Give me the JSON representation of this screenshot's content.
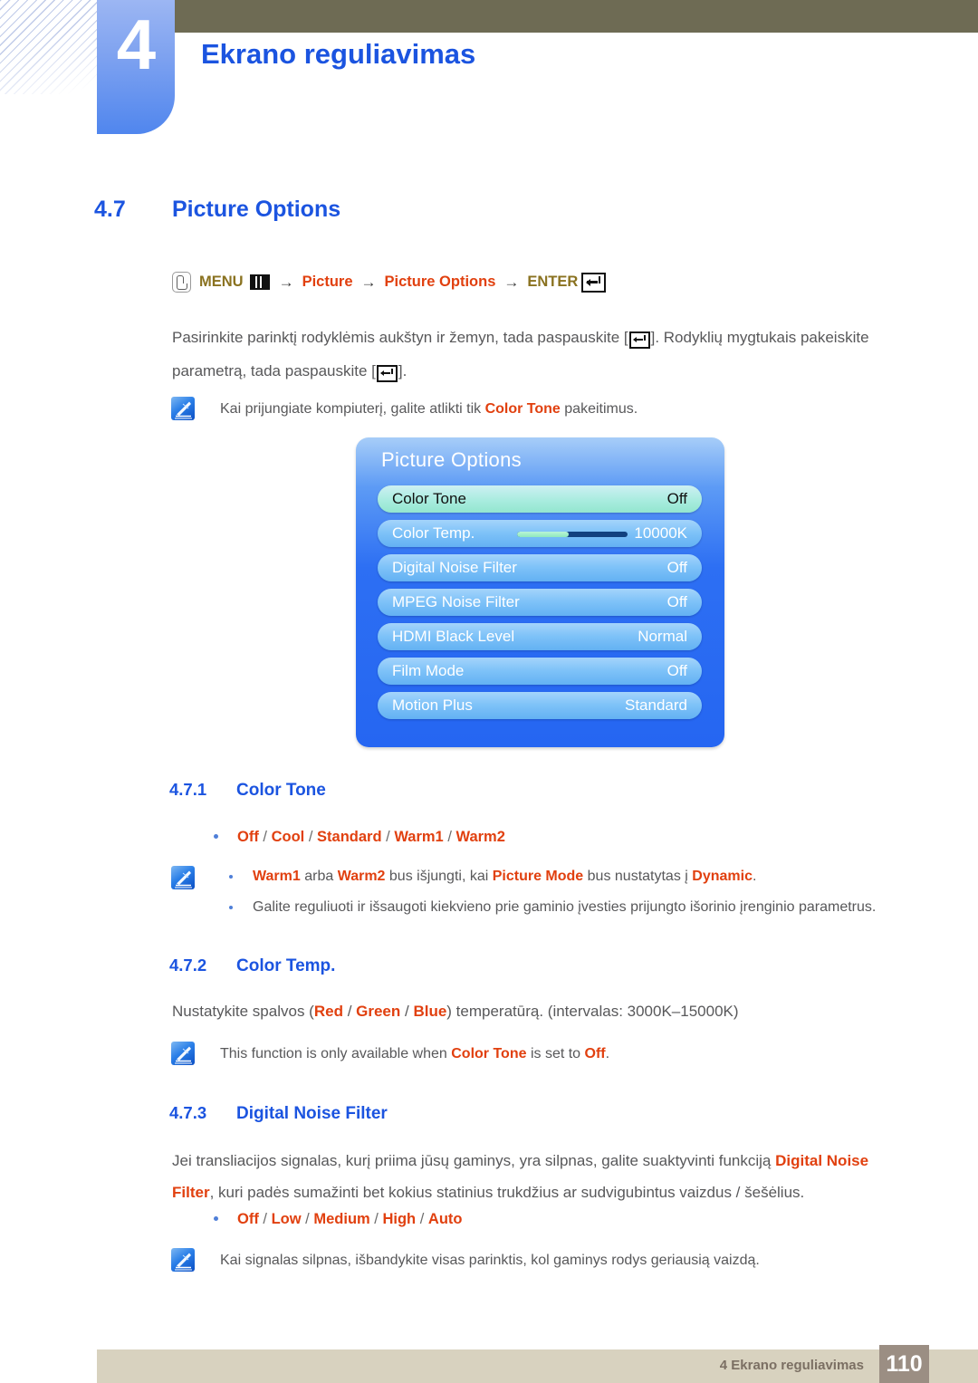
{
  "header": {
    "chapter_number": "4",
    "chapter_title": "Ekrano reguliavimas",
    "accent_blue": "#1b54e0",
    "olive_bar_color": "#6e6b54",
    "tab_gradient_from": "#9cb6f3",
    "tab_gradient_to": "#5086ee"
  },
  "section": {
    "number": "4.7",
    "title": "Picture Options"
  },
  "menu_path": {
    "press_icon": "press-hand-icon",
    "menu_label": "MENU",
    "grid_icon": "menu-grid-icon",
    "arrow": "→",
    "item1": "Picture",
    "item2": "Picture Options",
    "enter_label": "ENTER",
    "enter_icon": "enter-key-icon",
    "olive_color": "#8a7220",
    "orange_color": "#e1400f"
  },
  "intro": {
    "line1_a": "Pasirinkite parinktį rodyklėmis aukštyn ir žemyn, tada paspauskite [",
    "line1_b": "]. Rodyklių mygtukais pakeiskite",
    "line2_a": "parametrą, tada paspauskite [",
    "line2_b": "]."
  },
  "note_top": {
    "icon": "note-pen-icon",
    "text_a": "Kai prijungiate kompiuterį, galite atlikti tik ",
    "highlight": "Color Tone",
    "text_b": " pakeitimus."
  },
  "osd": {
    "title": "Picture Options",
    "rows": [
      {
        "label": "Color Tone",
        "value": "Off",
        "selected": true,
        "slider": false
      },
      {
        "label": "Color Temp.",
        "value": "10000K",
        "selected": false,
        "slider": true,
        "slider_fill_percent": 47
      },
      {
        "label": "Digital Noise Filter",
        "value": "Off",
        "selected": false,
        "slider": false
      },
      {
        "label": "MPEG Noise Filter",
        "value": "Off",
        "selected": false,
        "slider": false
      },
      {
        "label": "HDMI Black Level",
        "value": "Normal",
        "selected": false,
        "slider": false
      },
      {
        "label": "Film Mode",
        "value": "Off",
        "selected": false,
        "slider": false
      },
      {
        "label": "Motion Plus",
        "value": "Standard",
        "selected": false,
        "slider": false
      }
    ]
  },
  "sub471": {
    "number": "4.7.1",
    "title": "Color Tone",
    "options": [
      "Off",
      "Cool",
      "Standard",
      "Warm1",
      "Warm2"
    ],
    "note_icon": "note-pen-icon",
    "note1_parts": [
      {
        "t": "Warm1",
        "hl": true
      },
      {
        "t": " arba ",
        "hl": false
      },
      {
        "t": "Warm2",
        "hl": true
      },
      {
        "t": " bus išjungti, kai ",
        "hl": false
      },
      {
        "t": "Picture Mode",
        "hl": true
      },
      {
        "t": " bus nustatytas į ",
        "hl": false
      },
      {
        "t": "Dynamic",
        "hl": true
      },
      {
        "t": ".",
        "hl": false
      }
    ],
    "note2": "Galite reguliuoti ir išsaugoti kiekvieno prie gaminio įvesties prijungto išorinio įrenginio parametrus."
  },
  "sub472": {
    "number": "4.7.2",
    "title": "Color Temp.",
    "body_parts": [
      {
        "t": "Nustatykite spalvos (",
        "hl": false
      },
      {
        "t": "Red",
        "hl": true
      },
      {
        "t": " / ",
        "hl": false
      },
      {
        "t": "Green",
        "hl": true
      },
      {
        "t": " / ",
        "hl": false
      },
      {
        "t": "Blue",
        "hl": true
      },
      {
        "t": ") temperatūrą. (intervalas: 3000K–15000K)",
        "hl": false
      }
    ],
    "note_icon": "note-pen-icon",
    "note_parts": [
      {
        "t": "This function is only available when ",
        "hl": false
      },
      {
        "t": "Color Tone",
        "hl": true
      },
      {
        "t": " is set to ",
        "hl": false
      },
      {
        "t": "Off",
        "hl": true
      },
      {
        "t": ".",
        "hl": false
      }
    ]
  },
  "sub473": {
    "number": "4.7.3",
    "title": "Digital Noise Filter",
    "body_line1_parts": [
      {
        "t": "Jei transliacijos signalas, kurį priima jūsų gaminys, yra silpnas, galite suaktyvinti funkciją ",
        "hl": false
      },
      {
        "t": "Digital Noise",
        "hl": true
      }
    ],
    "body_line2_parts": [
      {
        "t": "Filter",
        "hl": true
      },
      {
        "t": ", kuri padės sumažinti bet kokius statinius trukdžius ar sudvigubintus vaizdus / šešėlius.",
        "hl": false
      }
    ],
    "options": [
      "Off",
      "Low",
      "Medium",
      "High",
      "Auto"
    ],
    "note_icon": "note-pen-icon",
    "note": "Kai signalas silpnas, išbandykite visas parinktis, kol gaminys rodys geriausią vaizdą."
  },
  "footer": {
    "label": "4 Ekrano reguliavimas",
    "page": "110",
    "bar_color": "#d8d2bf",
    "page_box_color": "#9b8e83"
  }
}
